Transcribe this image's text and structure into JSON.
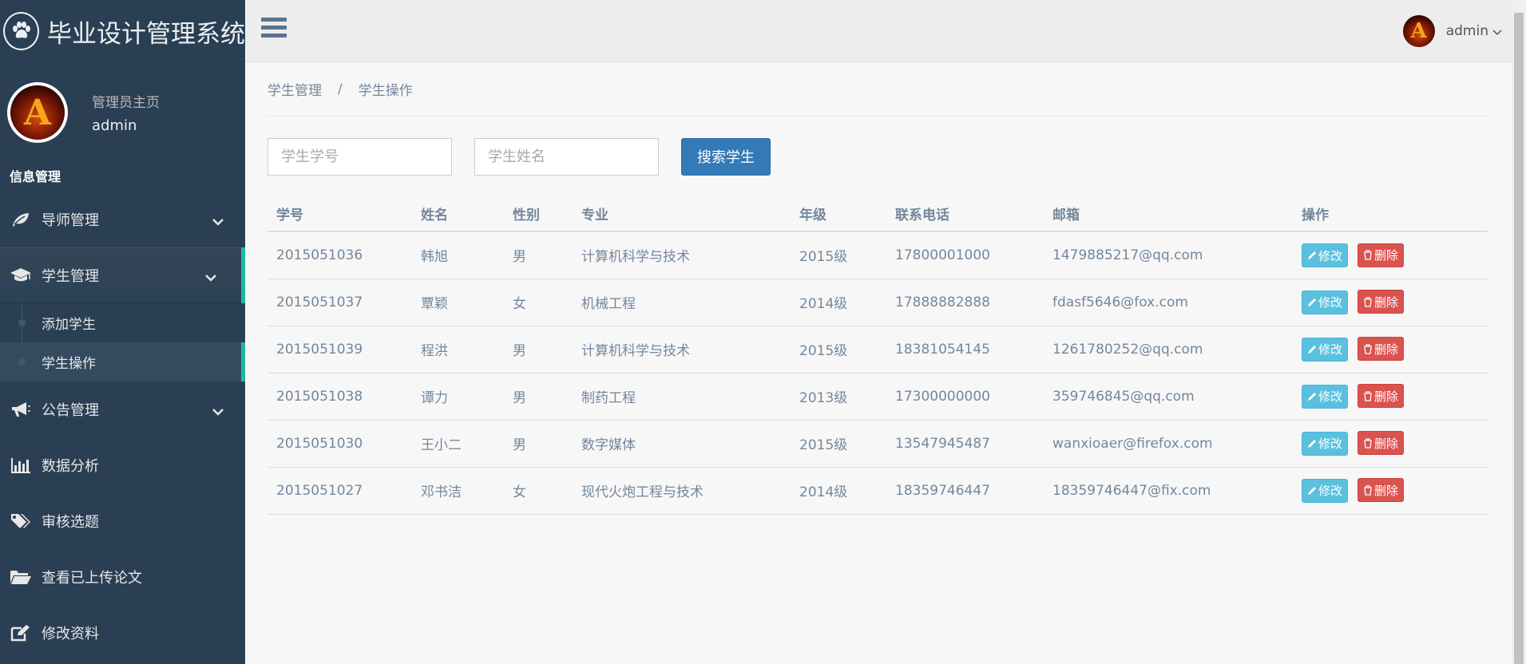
{
  "app": {
    "title": "毕业设计管理系统"
  },
  "profile": {
    "welcome": "管理员主页",
    "name": "admin",
    "avatar_letter": "A"
  },
  "sidebar": {
    "section_title": "信息管理",
    "items": [
      {
        "label": "导师管理",
        "icon": "leaf-icon"
      },
      {
        "label": "学生管理",
        "icon": "graduation-cap-icon"
      },
      {
        "label": "公告管理",
        "icon": "bullhorn-icon"
      },
      {
        "label": "数据分析",
        "icon": "bar-chart-icon"
      },
      {
        "label": "审核选题",
        "icon": "tags-icon"
      },
      {
        "label": "查看已上传论文",
        "icon": "folder-open-icon"
      },
      {
        "label": "修改资料",
        "icon": "edit-icon"
      }
    ],
    "student_children": [
      {
        "label": "添加学生"
      },
      {
        "label": "学生操作"
      }
    ]
  },
  "topnav": {
    "user_name": "admin",
    "avatar_letter": "A"
  },
  "breadcrumb": {
    "parent": "学生管理",
    "separator": "/",
    "current": "学生操作"
  },
  "search": {
    "id_placeholder": "学生学号",
    "name_placeholder": "学生姓名",
    "button_label": "搜索学生"
  },
  "table": {
    "headers": [
      "学号",
      "姓名",
      "性别",
      "专业",
      "年级",
      "联系电话",
      "邮箱",
      "操作"
    ],
    "edit_label": "修改",
    "delete_label": "删除",
    "rows": [
      [
        "2015051036",
        "韩旭",
        "男",
        "计算机科学与技术",
        "2015级",
        "17800001000",
        "1479885217@qq.com"
      ],
      [
        "2015051037",
        "覃颖",
        "女",
        "机械工程",
        "2014级",
        "17888882888",
        "fdasf5646@fox.com"
      ],
      [
        "2015051039",
        "程洪",
        "男",
        "计算机科学与技术",
        "2015级",
        "18381054145",
        "1261780252@qq.com"
      ],
      [
        "2015051038",
        "谭力",
        "男",
        "制药工程",
        "2013级",
        "17300000000",
        "359746845@qq.com"
      ],
      [
        "2015051030",
        "王小二",
        "男",
        "数字媒体",
        "2015级",
        "13547945487",
        "wanxioaer@firefox.com"
      ],
      [
        "2015051027",
        "邓书洁",
        "女",
        "现代火炮工程与技术",
        "2014级",
        "18359746447",
        "18359746447@fix.com"
      ]
    ]
  },
  "colors": {
    "sidebar_bg": "#2a3f54",
    "accent": "#1abb9c",
    "primary": "#337ab7",
    "info": "#5bc0de",
    "danger": "#d9534f"
  }
}
